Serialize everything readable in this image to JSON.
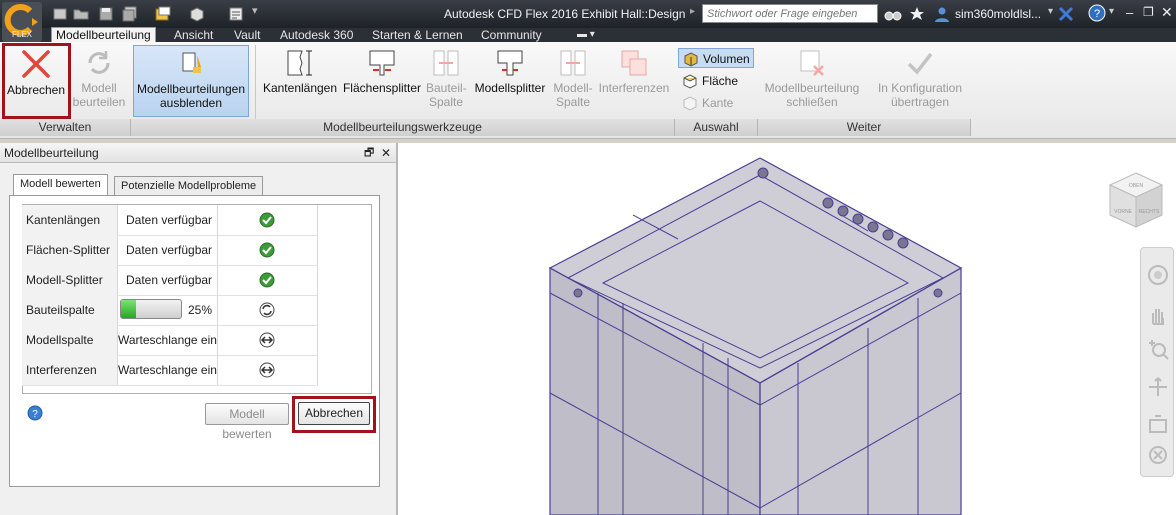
{
  "app": {
    "logo_text": "FLEX",
    "title": "Autodesk CFD Flex 2016   Exhibit Hall::Design",
    "search_placeholder": "Stichwort oder Frage eingeben",
    "user": "sim360moldlsl...",
    "help_label": "?"
  },
  "tabs": [
    {
      "label": "Modellbeurteilung",
      "active": true
    },
    {
      "label": "Ansicht"
    },
    {
      "label": "Vault"
    },
    {
      "label": "Autodesk 360"
    },
    {
      "label": "Starten & Lernen"
    },
    {
      "label": "Community"
    }
  ],
  "ribbon": {
    "verwalten": {
      "label": "Verwalten",
      "abbrechen": "Abbrechen",
      "modell_beurteilen": [
        "Modell",
        "beurteilen"
      ]
    },
    "werkzeuge": {
      "label": "Modellbeurteilungswerkzeuge",
      "ausblenden": [
        "Modellbeurteilungen",
        "ausblenden"
      ],
      "kantenlaengen": "Kantenlängen",
      "flaechensplitter": "Flächensplitter",
      "bauteil_spalte": [
        "Bauteil-",
        "Spalte"
      ],
      "modellsplitter": "Modellsplitter",
      "modell_spalte": [
        "Modell-",
        "Spalte"
      ],
      "interferenzen": "Interferenzen"
    },
    "auswahl": {
      "label": "Auswahl",
      "volumen": "Volumen",
      "flaeche": "Fläche",
      "kante": "Kante"
    },
    "weiter": {
      "label": "Weiter",
      "schliessen": [
        "Modellbeurteilung",
        "schließen"
      ],
      "uebertragen": [
        "In Konfiguration",
        "übertragen"
      ]
    }
  },
  "panel": {
    "title": "Modellbeurteilung",
    "tabs": [
      "Modell bewerten",
      "Potenzielle Modellprobleme"
    ],
    "rows": [
      {
        "name": "Kantenlängen",
        "status": "Daten verfügbar",
        "icon": "check-icon"
      },
      {
        "name": "Flächen-Splitter",
        "status": "Daten verfügbar",
        "icon": "check-icon"
      },
      {
        "name": "Modell-Splitter",
        "status": "Daten verfügbar",
        "icon": "check-icon"
      },
      {
        "name": "Bauteilspalte",
        "status": "25%",
        "progress": 0.25,
        "icon": "running-icon"
      },
      {
        "name": "Modellspalte",
        "status": "Warteschlange eing",
        "icon": "queued-icon"
      },
      {
        "name": "Interferenzen",
        "status": "Warteschlange eing",
        "icon": "queued-icon"
      }
    ],
    "btn_bewerten": "Modell bewerten",
    "btn_abbrechen": "Abbrechen"
  },
  "viewcube": {
    "top": "OBEN",
    "front": "VORNE",
    "right": "RECHTS"
  },
  "colors": {
    "accent": "#a3121c",
    "model_edge": "#4a3f96",
    "selected": "#c7dcf3"
  }
}
